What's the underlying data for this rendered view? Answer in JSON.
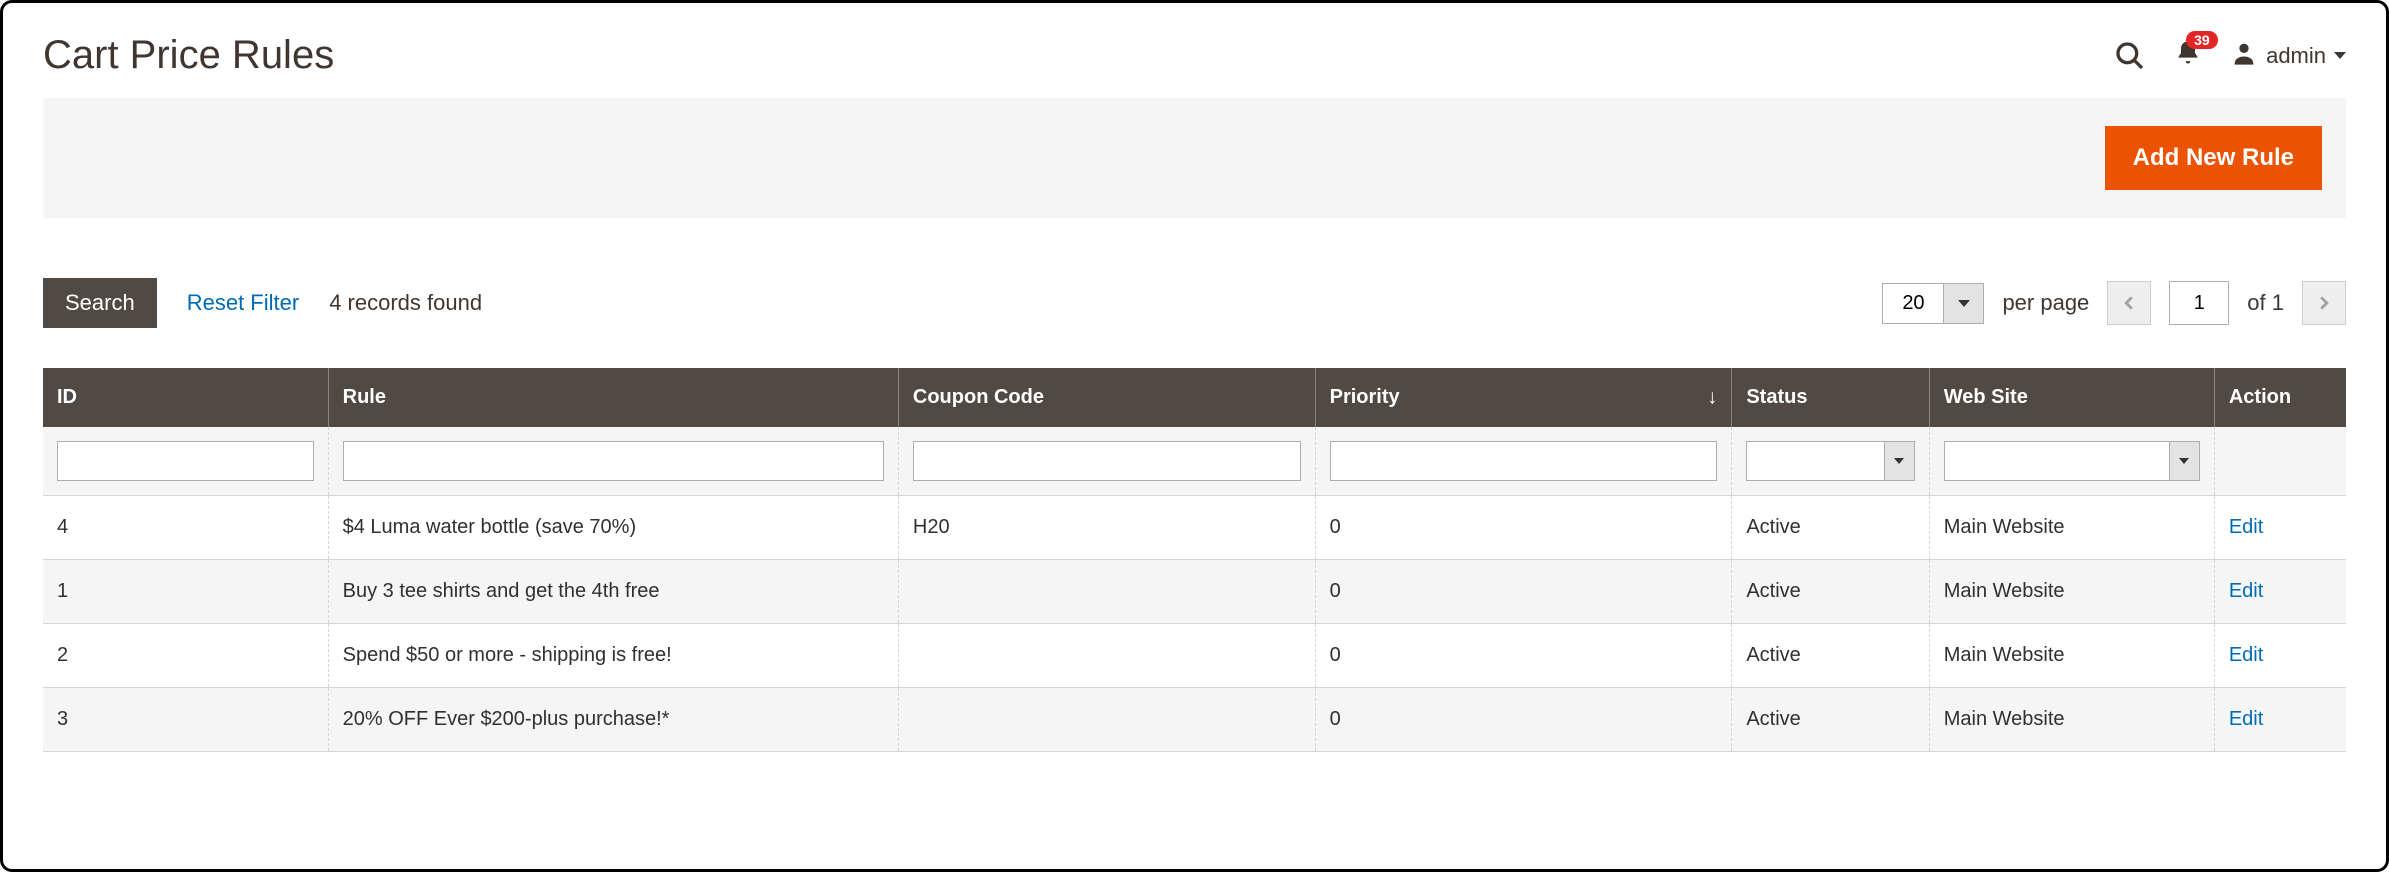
{
  "header": {
    "title": "Cart Price Rules",
    "notification_count": "39",
    "user_name": "admin"
  },
  "toolbar": {
    "add_new_label": "Add New Rule"
  },
  "controls": {
    "search_label": "Search",
    "reset_label": "Reset Filter",
    "records_found": "4 records found",
    "per_page_value": "20",
    "per_page_label": "per page",
    "current_page": "1",
    "of_label": "of 1"
  },
  "columns": {
    "id": "ID",
    "rule": "Rule",
    "coupon": "Coupon Code",
    "priority": "Priority",
    "status": "Status",
    "website": "Web Site",
    "action": "Action"
  },
  "rows": [
    {
      "id": "4",
      "rule": "$4 Luma water bottle (save 70%)",
      "coupon": "H20",
      "priority": "0",
      "status": "Active",
      "website": "Main Website",
      "edit": "Edit"
    },
    {
      "id": "1",
      "rule": "Buy 3 tee shirts and get the 4th free",
      "coupon": "",
      "priority": "0",
      "status": "Active",
      "website": "Main Website",
      "edit": "Edit"
    },
    {
      "id": "2",
      "rule": "Spend $50 or more - shipping is free!",
      "coupon": "",
      "priority": "0",
      "status": "Active",
      "website": "Main Website",
      "edit": "Edit"
    },
    {
      "id": "3",
      "rule": "20% OFF Ever $200-plus purchase!*",
      "coupon": "",
      "priority": "0",
      "status": "Active",
      "website": "Main Website",
      "edit": "Edit"
    }
  ]
}
